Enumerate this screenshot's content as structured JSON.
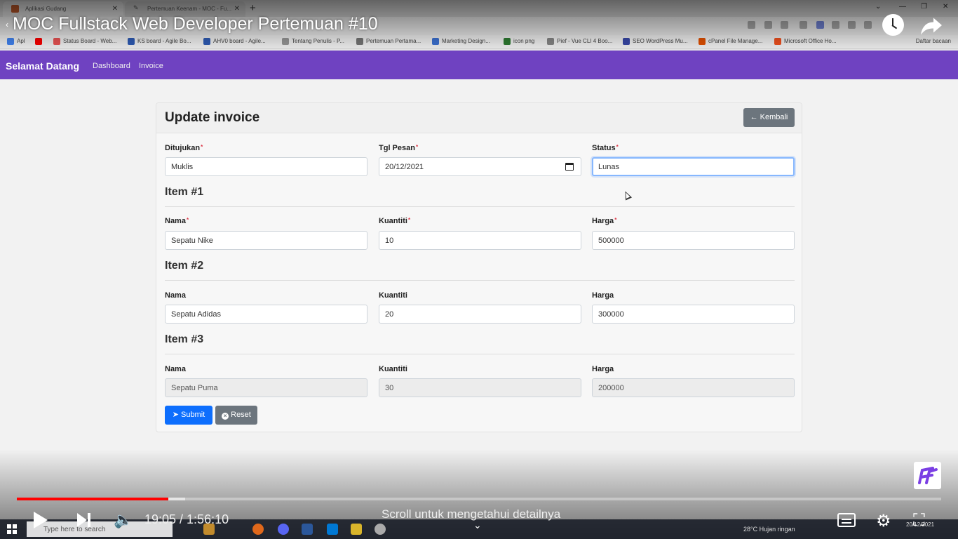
{
  "browser": {
    "tabs": [
      {
        "title": "Aplikasi Gudang"
      },
      {
        "title": "Pertemuan Keenam - MOC - Fu..."
      }
    ],
    "bookmarks": [
      {
        "label": "Apl",
        "color": "#4285f4"
      },
      {
        "label": "",
        "color": "#ff0000"
      },
      {
        "label": "Status Board - Web...",
        "color": "#e55"
      },
      {
        "label": "KS board - Agile Bo...",
        "color": "#2f5db8"
      },
      {
        "label": "AHV0 board - Agile...",
        "color": "#2f5db8"
      },
      {
        "label": "Tentang Penulis - P...",
        "color": "#999"
      },
      {
        "label": "Pertemuan Pertama...",
        "color": "#777"
      },
      {
        "label": "Marketing Design...",
        "color": "#3d73d6"
      },
      {
        "label": "icon png",
        "color": "#2e7d32"
      },
      {
        "label": "Pief - Vue CLI 4 Boo...",
        "color": "#888"
      },
      {
        "label": "SEO WordPress Mu...",
        "color": "#3949ab"
      },
      {
        "label": "cPanel File Manage...",
        "color": "#e65100"
      },
      {
        "label": "Microsoft Office Ho...",
        "color": "#f4511e"
      }
    ],
    "bookmarks_other": "Daftar bacaan"
  },
  "video": {
    "title": "MOC Fullstack Web Developer Pertemuan #10",
    "time": "19:05 / 1:56:10",
    "progress_fraction": 0.164,
    "buffer_fraction": 0.182,
    "scroll_hint": "Scroll untuk mengetahui detailnya"
  },
  "navbar": {
    "brand": "Selamat Datang",
    "links": [
      "Dashboard",
      "Invoice"
    ],
    "color": "#6f42c1"
  },
  "form": {
    "title": "Update invoice",
    "back_label": "Kembali",
    "header_fields": [
      {
        "label": "Ditujukan",
        "required": "*",
        "value": "Muklis"
      },
      {
        "label": "Tgl Pesan",
        "required": "*",
        "value": "20/12/2021"
      },
      {
        "label": "Status",
        "required": "*",
        "value": "Lunas"
      }
    ],
    "items": [
      {
        "title": "Item #1",
        "nama_label": "Nama",
        "kuantiti_label": "Kuantiti",
        "harga_label": "Harga",
        "required": "*",
        "nama": "Sepatu Nike",
        "kuantiti": "10",
        "harga": "500000"
      },
      {
        "title": "Item #2",
        "nama_label": "Nama",
        "kuantiti_label": "Kuantiti",
        "harga_label": "Harga",
        "nama": "Sepatu Adidas",
        "kuantiti": "20",
        "harga": "300000"
      },
      {
        "title": "Item #3",
        "nama_label": "Nama",
        "kuantiti_label": "Kuantiti",
        "harga_label": "Harga",
        "nama": "Sepatu Puma",
        "kuantiti": "30",
        "harga": "200000"
      }
    ],
    "submit_label": "Submit",
    "reset_label": "Reset"
  },
  "taskbar": {
    "search_placeholder": "Type here to search",
    "weather": "28°C  Hujan ringan",
    "date": "20/12/2021"
  }
}
